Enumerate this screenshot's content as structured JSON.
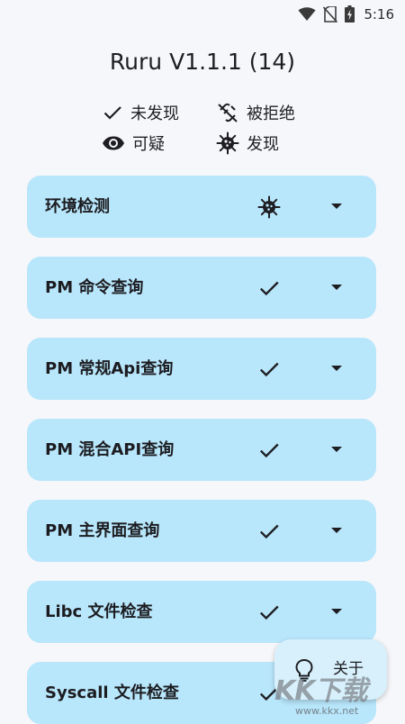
{
  "status_bar": {
    "time": "5:16",
    "icons": [
      "wifi-icon",
      "no-sim-icon",
      "battery-charging-icon"
    ]
  },
  "app_title": "Ruru V1.1.1 (14)",
  "legend": {
    "not_found": {
      "label": "未发现",
      "icon": "check-icon"
    },
    "denied": {
      "label": "被拒绝",
      "icon": "link-off-icon"
    },
    "suspicious": {
      "label": "可疑",
      "icon": "eye-icon"
    },
    "found": {
      "label": "发现",
      "icon": "virus-icon"
    }
  },
  "cards": [
    {
      "label": "环境检测",
      "status": "virus-icon"
    },
    {
      "label": "PM 命令查询",
      "status": "check-icon"
    },
    {
      "label": "PM 常规Api查询",
      "status": "check-icon"
    },
    {
      "label": "PM 混合API查询",
      "status": "check-icon"
    },
    {
      "label": "PM 主界面查询",
      "status": "check-icon"
    },
    {
      "label": "Libc 文件检查",
      "status": "check-icon"
    },
    {
      "label": "Syscall 文件检查",
      "status": "check-icon"
    }
  ],
  "fab": {
    "label": "关于",
    "icon": "lightbulb-icon"
  },
  "watermark": {
    "text": "KK下载",
    "url": "www.kkx.net"
  }
}
